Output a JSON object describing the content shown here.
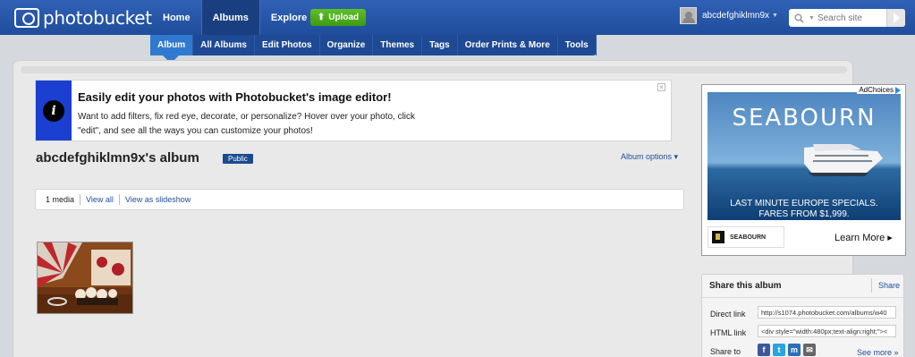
{
  "header": {
    "logo_text": "photobucket",
    "nav": [
      "Home",
      "Albums",
      "Explore"
    ],
    "upload_label": "Upload",
    "username": "abcdefghiklmn9x",
    "search_placeholder": "Search site"
  },
  "subnav": [
    "Album",
    "All Albums",
    "Edit Photos",
    "Organize",
    "Themes",
    "Tags",
    "Order Prints & More",
    "Tools"
  ],
  "notice": {
    "title": "Easily edit your photos with Photobucket's image editor!",
    "line1": "Want to add filters, fix red eye, decorate, or personalize? Hover over your photo, click",
    "line2": "\"edit\", and see all the ways you can customize your photos!",
    "close": "×"
  },
  "album": {
    "title": "abcdefghiklmn9x's album",
    "badge": "Public",
    "options_label": "Album options ▾",
    "media_count": "1 media",
    "view_all": "View all",
    "view_slideshow": "View as slideshow"
  },
  "ad": {
    "adchoices": "AdChoices",
    "brand": "SEABOURN",
    "tagline1": "LAST MINUTE EUROPE SPECIALS.",
    "tagline2": "FARES FROM $1,999.",
    "footer_brand": "SEABOURN",
    "cta": "Learn More ▸"
  },
  "share": {
    "title": "Share this album",
    "share_button": "Share",
    "direct_label": "Direct link",
    "direct_value": "http://s1074.photobucket.com/albums/w40",
    "html_label": "HTML link",
    "html_value": "<div style=\"width:480px;text-align:right;\"><",
    "share_to": "Share to",
    "see_more": "See more »"
  },
  "colors": {
    "header_blue": "#2a5aab",
    "upload_green": "#4caf1e",
    "notice_blue": "#1a3fd1",
    "link_blue": "#1f4d9a"
  }
}
